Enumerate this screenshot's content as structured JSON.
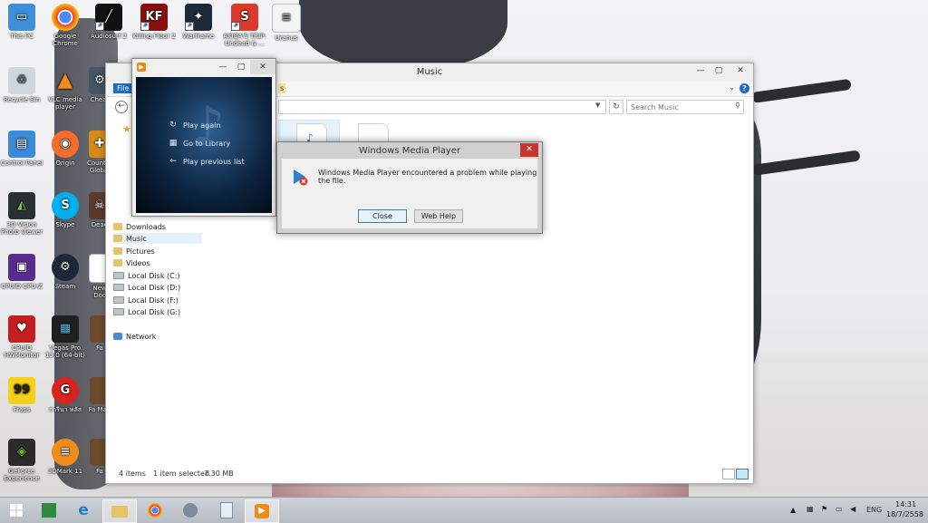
{
  "desktop": {
    "icons": [
      {
        "label": "This PC"
      },
      {
        "label": "Google Chrome"
      },
      {
        "label": "Audiosurf 2"
      },
      {
        "label": "Killing Floor 2"
      },
      {
        "label": "Warframe"
      },
      {
        "label": "AKIBA'S TRIP: Undead & ..."
      },
      {
        "label": "Uranus"
      },
      {
        "label": "Recycle Bin"
      },
      {
        "label": "VLC media player"
      },
      {
        "label": "Cheat"
      },
      {
        "label": "Control Panel"
      },
      {
        "label": "Origin"
      },
      {
        "label": "Counter Global"
      },
      {
        "label": "3D Vision Photo Viewer"
      },
      {
        "label": "Skype"
      },
      {
        "label": "Dead"
      },
      {
        "label": "CPUID CPU-Z"
      },
      {
        "label": "Steam"
      },
      {
        "label": "New Doc"
      },
      {
        "label": "CPUID HWMonitor"
      },
      {
        "label": "Vegas Pro 13.0 (64-bit)"
      },
      {
        "label": "Fa"
      },
      {
        "label": "Fraps"
      },
      {
        "label": "การีนา พลัส"
      },
      {
        "label": "Fa Map"
      },
      {
        "label": "GeForce Experience"
      },
      {
        "label": "3DMark 11"
      },
      {
        "label": "Fa"
      }
    ]
  },
  "explorer": {
    "title": "Music",
    "ribbon_tab": "File",
    "ribbon_tab_fragment": "s",
    "search_placeholder": "Search Music",
    "nav": [
      {
        "label": "Downloads"
      },
      {
        "label": "Music"
      },
      {
        "label": "Pictures"
      },
      {
        "label": "Videos"
      },
      {
        "label": "Local Disk (C:)"
      },
      {
        "label": "Local Disk (D:)"
      },
      {
        "label": "Local Disk (F:)"
      },
      {
        "label": "Local Disk (G:)"
      },
      {
        "label": "Network"
      }
    ],
    "status": {
      "items": "4 items",
      "selected": "1 item selected",
      "size": "7.30 MB"
    }
  },
  "wmp": {
    "options": [
      {
        "label": "Play again",
        "glyph": "↻"
      },
      {
        "label": "Go to Library",
        "glyph": "▦"
      },
      {
        "label": "Play previous list",
        "glyph": "←"
      }
    ]
  },
  "dialog": {
    "title": "Windows Media Player",
    "message": "Windows Media Player encountered a problem while playing the file.",
    "close_label": "Close",
    "webhelp_label": "Web Help"
  },
  "taskbar": {
    "lang": "ENG",
    "time": "14:31",
    "date": "18/7/2558"
  },
  "colors": {
    "accent": "#1a6cc9",
    "close_red": "#c7372f",
    "wmp_orange": "#f08b1d"
  }
}
